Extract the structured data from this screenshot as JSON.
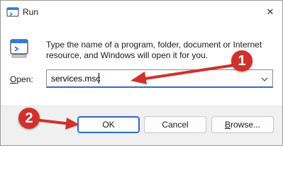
{
  "window": {
    "title": "Run",
    "close_label": "✕"
  },
  "dialog": {
    "description": "Type the name of a program, folder, document or Internet resource, and Windows will open it for you.",
    "open_label_accel": "O",
    "open_label_rest": "pen:",
    "open_value": "services.msc"
  },
  "buttons": {
    "ok": "OK",
    "cancel": "Cancel",
    "browse_accel": "B",
    "browse_rest": "rowse..."
  },
  "annotations": {
    "step1": "1",
    "step2": "2",
    "accent_color": "#d0312d"
  }
}
